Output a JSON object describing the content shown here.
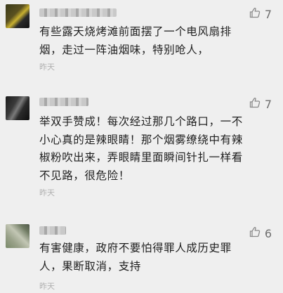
{
  "comments": [
    {
      "text_lines": [
        "有些露天烧烤滩前面摆了一个电风扇排",
        "烟，走过一阵油烟味，特别呛人，"
      ],
      "time": "昨天",
      "likes": "7"
    },
    {
      "text_lines": [
        "举双手赞成！每次经过那几个路口，一不",
        "小心真的是辣眼睛！那个烟雾缭绕中有辣",
        "椒粉吹出来，弄眼睛里面瞬间针扎一样看",
        "不见路，很危险！"
      ],
      "time": "昨天",
      "likes": "7"
    },
    {
      "text_lines": [
        "有害健康，政府不要怕得罪人成历史罪",
        "人，果断取消，支持"
      ],
      "time": "昨天",
      "likes": "6"
    }
  ],
  "icons": {
    "like": "thumbs-up-icon"
  },
  "colors": {
    "background": "#efefef",
    "text": "#1f1f1f",
    "meta": "#b0b0b0",
    "like": "#8a8a8a"
  }
}
